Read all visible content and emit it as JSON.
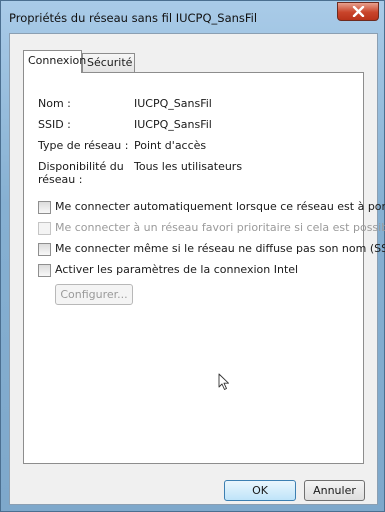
{
  "window": {
    "title": "Propriétés du réseau sans fil IUCPQ_SansFil",
    "close_icon": "close-icon"
  },
  "tabs": [
    {
      "label": "Connexion",
      "active": true
    },
    {
      "label": "Sécurité",
      "active": false
    }
  ],
  "fields": [
    {
      "label": "Nom :",
      "value": "IUCPQ_SansFil"
    },
    {
      "label": "SSID :",
      "value": "IUCPQ_SansFil"
    },
    {
      "label": "Type de réseau :",
      "value": "Point d'accès"
    },
    {
      "label_line1": "Disponibilité du",
      "label_line2": "réseau :",
      "value": "Tous les utilisateurs"
    }
  ],
  "checkboxes": [
    {
      "label": "Me connecter automatiquement lorsque ce réseau est à portée",
      "checked": false,
      "disabled": false
    },
    {
      "label": "Me connecter à un réseau favori prioritaire si cela est possible",
      "checked": false,
      "disabled": true
    },
    {
      "label": "Me connecter même si le réseau ne diffuse pas son nom (SSID)",
      "checked": false,
      "disabled": false
    },
    {
      "label": "Activer les paramètres de la connexion Intel",
      "checked": false,
      "disabled": false
    }
  ],
  "configure_button": {
    "label": "Configurer...",
    "disabled": true
  },
  "footer": {
    "ok_label": "OK",
    "cancel_label": "Annuler"
  },
  "cursor_icon": "mouse-pointer-icon"
}
